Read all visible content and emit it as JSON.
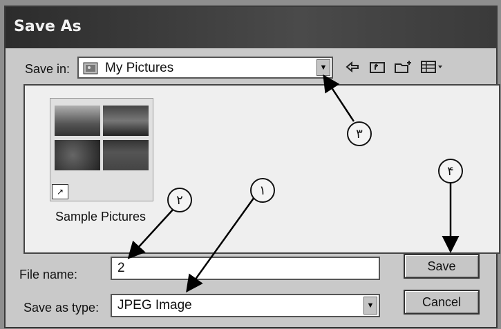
{
  "dialog": {
    "title": "Save As"
  },
  "save_in": {
    "label": "Save in:",
    "value": "My Pictures",
    "icon": "my-pictures-icon"
  },
  "toolbar": [
    "back-arrow-icon",
    "up-folder-icon",
    "new-folder-icon",
    "view-menu-icon"
  ],
  "file_list": {
    "items": [
      {
        "name": "Sample Pictures",
        "icon": "folder-thumbnail-icon"
      }
    ]
  },
  "file_name": {
    "label": "File name:",
    "value": "2"
  },
  "save_type": {
    "label": "Save as type:",
    "value": "JPEG Image"
  },
  "buttons": {
    "save": "Save",
    "cancel": "Cancel"
  },
  "callouts": {
    "c1": "١",
    "c2": "٢",
    "c3": "٣",
    "c4": "۴"
  }
}
